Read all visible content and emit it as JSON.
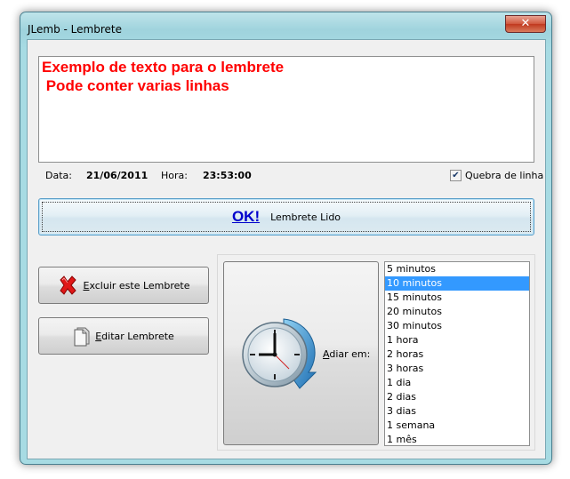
{
  "window": {
    "title": "JLemb - Lembrete",
    "close_label": "✕"
  },
  "reminder": {
    "lines": [
      "Exemplo de texto para o lembrete",
      " Pode conter varias linhas"
    ],
    "text_color": "#ff0000"
  },
  "info": {
    "date_label": "Data:",
    "date_value": "21/06/2011",
    "time_label": "Hora:",
    "time_value": "23:53:00",
    "wrap_label": "Quebra de linha",
    "wrap_checked": true
  },
  "ok_button": {
    "big_label": "OK!",
    "small_label": "Lembrete Lido"
  },
  "buttons": {
    "delete_first": "E",
    "delete_rest": "xcluir este Lembrete",
    "edit_first": "E",
    "edit_rest": "ditar Lembrete"
  },
  "snooze": {
    "label_first": "A",
    "label_rest": "diar em:",
    "options": [
      "5 minutos",
      "10 minutos",
      "15 minutos",
      "20 minutos",
      "30 minutos",
      "1 hora",
      "2 horas",
      "3 horas",
      "1 dia",
      "2 dias",
      "3 dias",
      "1 semana",
      "1 mês"
    ],
    "selected": "10 minutos"
  },
  "colors": {
    "accent": "#3399ff",
    "ok_text": "#0000cc"
  },
  "icons": {
    "delete": "red-x-icon",
    "edit": "document-icon",
    "snooze": "clock-arrow-icon"
  }
}
